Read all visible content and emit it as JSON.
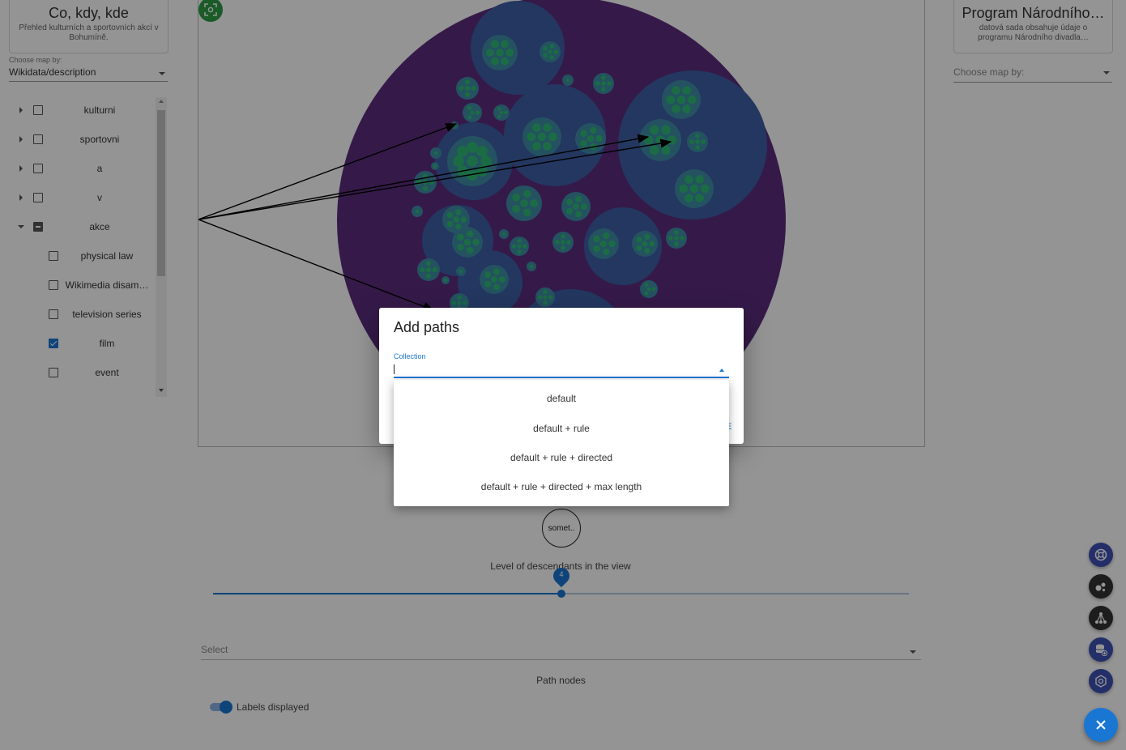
{
  "left_dataset": {
    "title": "Co, kdy, kde",
    "description": "Přehled kulturních a sportovních akcí v Bohumíně."
  },
  "left_select": {
    "label": "Choose map by:",
    "value": "Wikidata/description"
  },
  "right_dataset": {
    "title": "Program Národního…",
    "description": "datová sada obsahuje údaje o programu Národního divadla…"
  },
  "right_select": {
    "placeholder": "Choose map by:"
  },
  "tree": [
    {
      "label": "kulturni",
      "state": "unchecked",
      "expandable": true,
      "expanded": false
    },
    {
      "label": "sportovni",
      "state": "unchecked",
      "expandable": true,
      "expanded": false
    },
    {
      "label": "a",
      "state": "unchecked",
      "expandable": true,
      "expanded": false
    },
    {
      "label": "v",
      "state": "unchecked",
      "expandable": true,
      "expanded": false
    },
    {
      "label": "akce",
      "state": "indeterminate",
      "expandable": true,
      "expanded": true
    },
    {
      "label": "physical law",
      "state": "unchecked",
      "child": true
    },
    {
      "label": "Wikimedia disam…",
      "state": "unchecked",
      "child": true
    },
    {
      "label": "television series",
      "state": "unchecked",
      "child": true
    },
    {
      "label": "film",
      "state": "checked",
      "child": true
    },
    {
      "label": "event",
      "state": "unchecked",
      "child": true
    }
  ],
  "node_label": "somet..",
  "slider": {
    "label": "Level of descendants in the view",
    "value": 4,
    "min": 0,
    "max": 8
  },
  "bottom_select": {
    "placeholder": "Select"
  },
  "path_nodes_label": "Path nodes",
  "labels_toggle": {
    "label": "Labels displayed",
    "on": true
  },
  "dialog": {
    "title": "Add paths",
    "collection_label": "Collection",
    "action_fragment": "E"
  },
  "dropdown_options": [
    "default",
    "default + rule",
    "default + rule + directed",
    "default + rule + directed + max length"
  ],
  "fab_icons": [
    "lifebuoy-icon",
    "bubbles-icon",
    "hierarchy-icon",
    "database-add-icon",
    "network-icon",
    "close-icon"
  ],
  "colors": {
    "accent": "#1976d2",
    "canvas_bg": "#5c2d7e",
    "bubble_blue": "#3d5fa6",
    "bubble_teal": "#3f8ea8",
    "leaf_green": "#2fbf70",
    "fab_blue": "#3f51b5",
    "fab_dark": "#333333",
    "zoom_green": "#2e9e45"
  }
}
